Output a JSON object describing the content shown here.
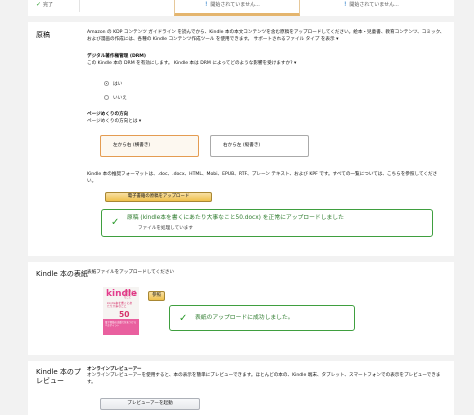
{
  "top": {
    "c1": "完了",
    "c2": "開始されていません...",
    "c3": "開始されていません..."
  },
  "manuscript": {
    "heading": "原稿",
    "desc1": "Amazon の KDP コンテンツ ガイドライン を読んでから、Kindle 本の本文コンテンツを含む原稿をアップロードしてください。絵本・児童書、教育コンテンツ、コミック、および漫画の作成には、各種の Kindle コンテンツ作成ツール を使用できます。 サポートされるファイル タイプ を表示 ▾",
    "drm_title": "デジタル著作権管理 (DRM)",
    "drm_desc": "この Kindle 本の DRM を有効にします。 Kindle 本は DRM によってどのような影響を受けますか? ▾",
    "yes": "はい",
    "no": "いいえ",
    "dir_title": "ページめくりの方向",
    "dir_link": "ページめくりの方向とは ▾",
    "rtl": "左から右 (横書き)",
    "ltr": "右から左 (縦書き)",
    "formats": "Kindle 本の推奨フォーマットは、.doc、.docx、HTML、Mobi、EPUB、RTF、プレーン テキスト、および KPF です。すべての一覧については、こちらを参照してください。",
    "upload_btn": "電子書籍の原稿をアップロード",
    "success_title": "原稿 (kindle本を書くにあたり大事なこと50.docx) を正常にアップロードしました",
    "success_sub": "ファイルを処理しています"
  },
  "cover": {
    "heading": "Kindle 本の表紙",
    "desc": "表紙ファイルをアップロードしてください",
    "button": "参照",
    "success": "表紙のアップロードに成功しました。",
    "book": {
      "kindle": "kindle",
      "top_text": "本を書くにあたり大事なこと",
      "title": "kindle本を書くにあたり大事なこと",
      "num": "50",
      "band": "電子書籍の出版で気をつけるべきポイント"
    }
  },
  "preview": {
    "heading": "Kindle 本のプレビュー",
    "title": "オンラインプレビューアー",
    "desc": "オンラインプレビューアーを使用すると、本の表示を簡単にプレビューできます。ほとんどの本の、Kindle 端末、タブレット、スマートフォンでの表示をプレビューできます。",
    "button": "プレビューアーを起動"
  },
  "colors": {
    "accent": "#0066c0",
    "success": "#3f9f3f",
    "button_yellow": "#f0c14b",
    "selected_border": "#e49c52"
  }
}
